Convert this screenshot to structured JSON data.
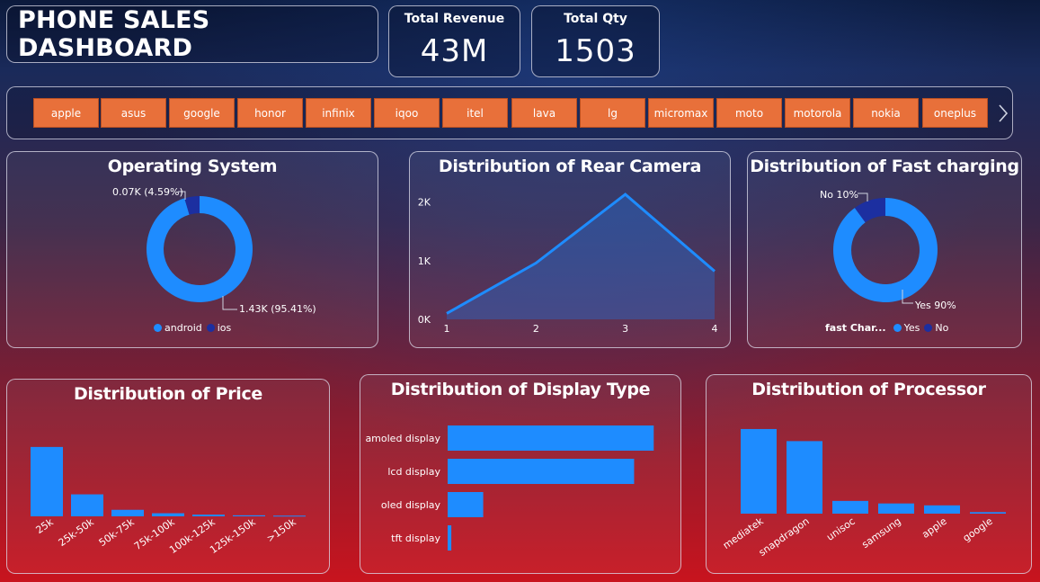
{
  "header": {
    "title": "PHONE SALES DASHBOARD"
  },
  "kpis": {
    "revenue": {
      "label": "Total Revenue",
      "value": "43M"
    },
    "qty": {
      "label": "Total Qty",
      "value": "1503"
    }
  },
  "slicer": {
    "brands": [
      "apple",
      "asus",
      "google",
      "honor",
      "infinix",
      "iqoo",
      "itel",
      "lava",
      "lg",
      "micromax",
      "moto",
      "motorola",
      "nokia",
      "oneplus"
    ],
    "next_icon": "chevron-right-icon"
  },
  "colors": {
    "series_primary": "#1e8cff",
    "series_secondary": "#1c2fa0",
    "slicer_button": "#e8703a"
  },
  "os": {
    "title": "Operating System",
    "small_label": "0.07K (4.59%)",
    "large_label": "1.43K (95.41%)",
    "legend": [
      "android",
      "ios"
    ]
  },
  "rear": {
    "title": "Distribution of Rear Camera"
  },
  "fast": {
    "title": "Distribution of Fast charging",
    "small_label": "No 10%",
    "large_label": "Yes 90%",
    "legend_title": "fast Char...",
    "legend": [
      "Yes",
      "No"
    ]
  },
  "price": {
    "title": "Distribution of Price"
  },
  "display": {
    "title": "Distribution of Display Type"
  },
  "processor": {
    "title": "Distribution of Processor"
  },
  "chart_data": [
    {
      "id": "os",
      "type": "pie",
      "donut": true,
      "title": "Operating System",
      "categories": [
        "android",
        "ios"
      ],
      "values": [
        1430,
        70
      ],
      "percent": [
        95.41,
        4.59
      ],
      "legend_placement": "bottom"
    },
    {
      "id": "rear",
      "type": "area",
      "title": "Distribution of Rear Camera",
      "x": [
        1,
        2,
        3,
        4
      ],
      "values": [
        100,
        960,
        2130,
        820
      ],
      "x_ticks": [
        "1",
        "2",
        "3",
        "4"
      ],
      "y_ticks": [
        "0K",
        "1K",
        "2K"
      ],
      "ylim": [
        0,
        2300
      ]
    },
    {
      "id": "fast",
      "type": "pie",
      "donut": true,
      "title": "Distribution of Fast charging",
      "categories": [
        "Yes",
        "No"
      ],
      "percent": [
        90,
        10
      ],
      "legend_placement": "bottom"
    },
    {
      "id": "price",
      "type": "bar",
      "title": "Distribution of Price",
      "categories": [
        "25k",
        "25k-50k",
        "50k-75k",
        "75k-100k",
        "100k-125k",
        "125k-150k",
        ">150k"
      ],
      "values": [
        1010,
        320,
        95,
        45,
        25,
        15,
        10
      ],
      "ylim": [
        0,
        1100
      ]
    },
    {
      "id": "display",
      "type": "bar",
      "orientation": "horizontal",
      "title": "Distribution of Display Type",
      "categories": [
        "amoled display",
        "lcd display",
        "oled display",
        "tft display"
      ],
      "values": [
        840,
        760,
        145,
        15
      ],
      "xlim": [
        0,
        850
      ]
    },
    {
      "id": "processor",
      "type": "bar",
      "title": "Distribution of Processor",
      "categories": [
        "mediatek",
        "snapdragon",
        "unisoc",
        "samsung",
        "apple",
        "google"
      ],
      "values": [
        665,
        570,
        100,
        80,
        65,
        12
      ],
      "ylim": [
        0,
        700
      ]
    }
  ]
}
